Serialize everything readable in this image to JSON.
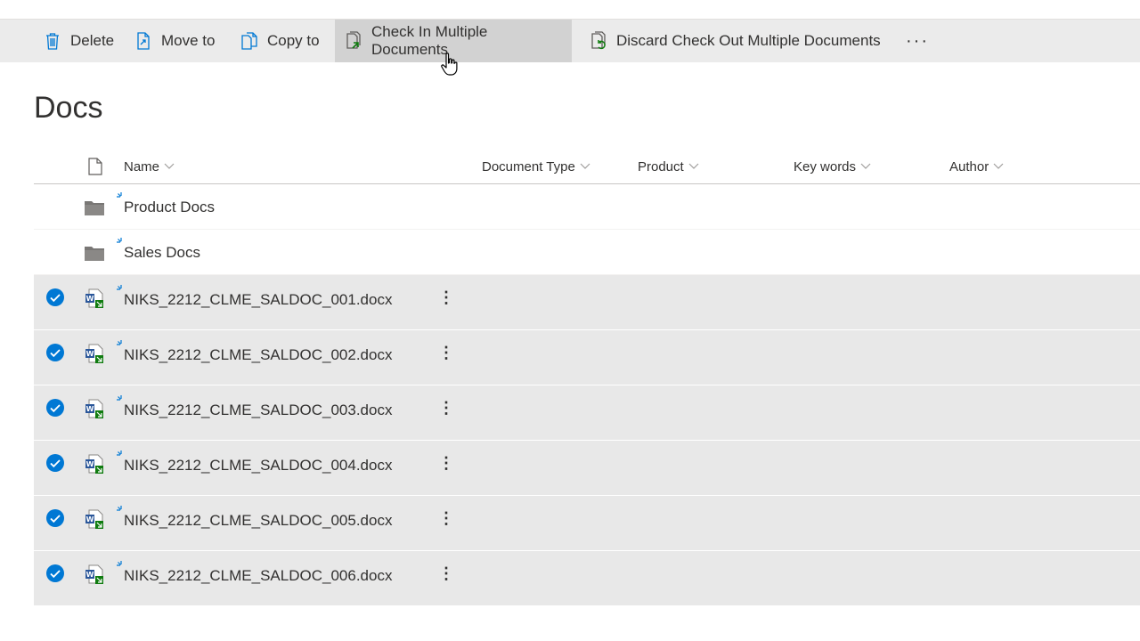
{
  "commandbar": {
    "delete": "Delete",
    "move_to": "Move to",
    "copy_to": "Copy to",
    "check_in": "Check In Multiple Documents",
    "discard": "Discard Check Out Multiple Documents",
    "more": "···"
  },
  "library": {
    "title": "Docs"
  },
  "columns": {
    "name": "Name",
    "document_type": "Document Type",
    "product": "Product",
    "key_words": "Key words",
    "author": "Author"
  },
  "folders": [
    {
      "name": "Product Docs"
    },
    {
      "name": "Sales Docs"
    }
  ],
  "files": [
    {
      "name": "NIKS_2212_CLME_SALDOC_001.docx",
      "selected": true
    },
    {
      "name": "NIKS_2212_CLME_SALDOC_002.docx",
      "selected": true
    },
    {
      "name": "NIKS_2212_CLME_SALDOC_003.docx",
      "selected": true
    },
    {
      "name": "NIKS_2212_CLME_SALDOC_004.docx",
      "selected": true
    },
    {
      "name": "NIKS_2212_CLME_SALDOC_005.docx",
      "selected": true
    },
    {
      "name": "NIKS_2212_CLME_SALDOC_006.docx",
      "selected": true
    }
  ],
  "colors": {
    "accent": "#0078d4",
    "word_blue": "#2b579a",
    "checkin_green": "#107c10",
    "selected_row": "#e8e8e8",
    "commandbar_bg": "#ebebeb"
  }
}
